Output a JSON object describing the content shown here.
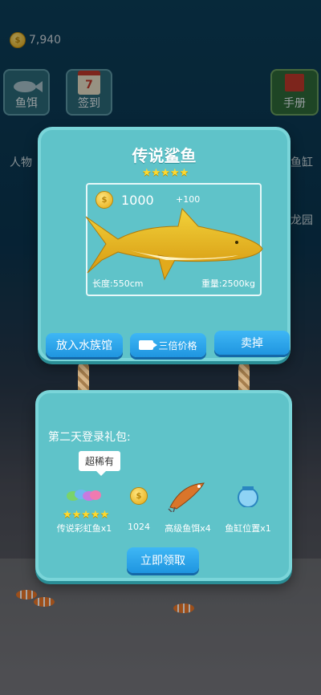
{
  "hud": {
    "coins": "7,940"
  },
  "top_buttons": {
    "bait": "鱼饵",
    "checkin": "签到",
    "checkin_day": "7",
    "handbook": "手册"
  },
  "side": {
    "character": "人物",
    "tank": "鱼缸",
    "dragon": "龙园"
  },
  "fish_panel": {
    "title": "传说鲨鱼",
    "stars": "★★★★★",
    "price": "1000",
    "bonus": "+100",
    "length": "长度:550cm",
    "weight": "重量:2500kg",
    "btn_aquarium": "放入水族馆",
    "btn_triple": "三倍价格",
    "btn_sell": "卖掉"
  },
  "gift_panel": {
    "title": "第二天登录礼包:",
    "tag": "超稀有",
    "stars": "★★★★★",
    "rewards": [
      {
        "label": "传说彩虹鱼x1"
      },
      {
        "label": "1024"
      },
      {
        "label": "高级鱼饵x4"
      },
      {
        "label": "鱼缸位置x1"
      }
    ],
    "btn_claim": "立即领取"
  }
}
